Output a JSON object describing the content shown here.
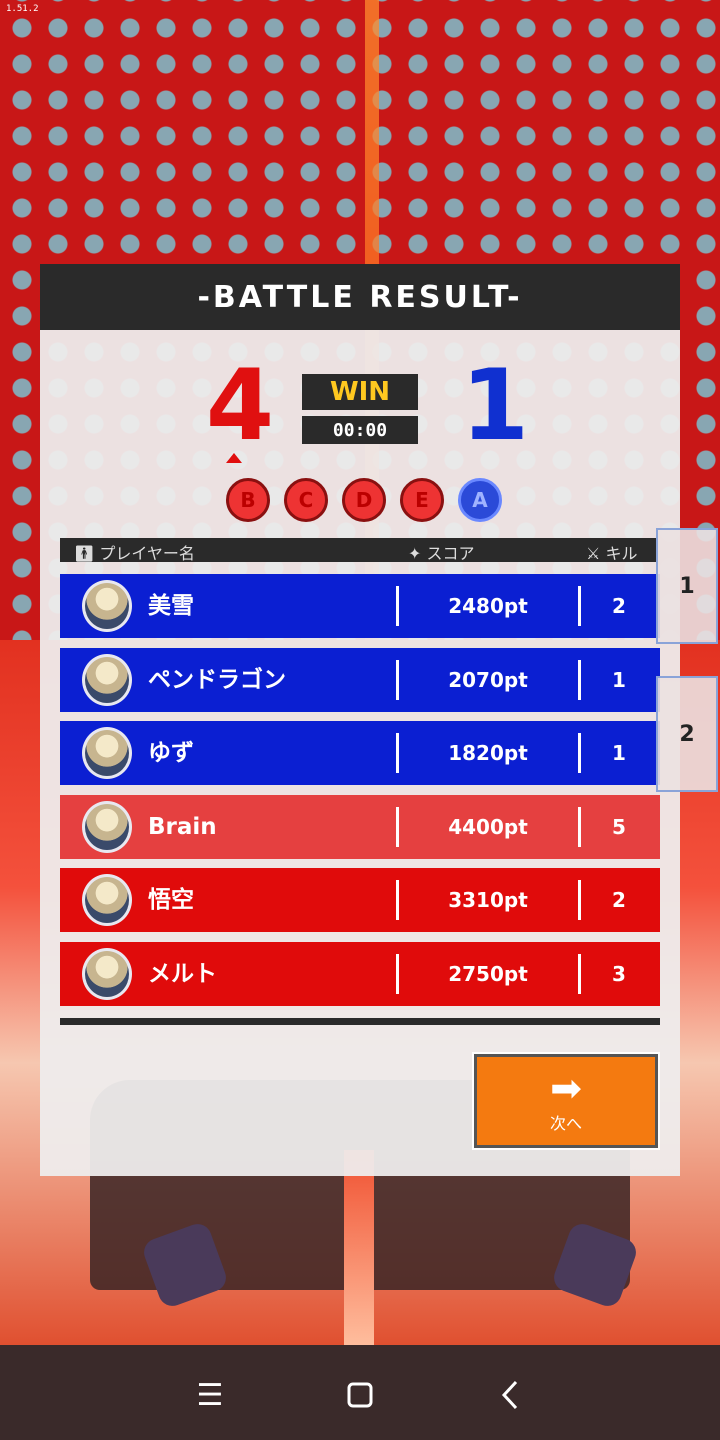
{
  "version": "1.51.2",
  "header": {
    "title": "-BATTLE RESULT-"
  },
  "score": {
    "red": "4",
    "blue": "1",
    "result": "WIN",
    "time": "00:00"
  },
  "rounds": [
    {
      "label": "B",
      "team": "red"
    },
    {
      "label": "C",
      "team": "red"
    },
    {
      "label": "D",
      "team": "red"
    },
    {
      "label": "E",
      "team": "red"
    },
    {
      "label": "A",
      "team": "blue"
    }
  ],
  "columns": {
    "player": "プレイヤー名",
    "score": "スコア",
    "kill": "キル"
  },
  "players": [
    {
      "name": "美雪",
      "score": "2480pt",
      "kill": "2",
      "team": "blue"
    },
    {
      "name": "ペンドラゴン",
      "score": "2070pt",
      "kill": "1",
      "team": "blue"
    },
    {
      "name": "ゆず",
      "score": "1820pt",
      "kill": "1",
      "team": "blue"
    },
    {
      "name": "Brain",
      "score": "4400pt",
      "kill": "5",
      "team": "red"
    },
    {
      "name": "悟空",
      "score": "3310pt",
      "kill": "2",
      "team": "red"
    },
    {
      "name": "メルト",
      "score": "2750pt",
      "kill": "3",
      "team": "red"
    }
  ],
  "next_button": {
    "label": "次へ",
    "icon": "arrow-right-icon"
  },
  "side_tabs": [
    "1",
    "2"
  ],
  "nav": {
    "menu_icon": "menu-icon",
    "home_icon": "home-icon",
    "back_icon": "back-icon"
  }
}
